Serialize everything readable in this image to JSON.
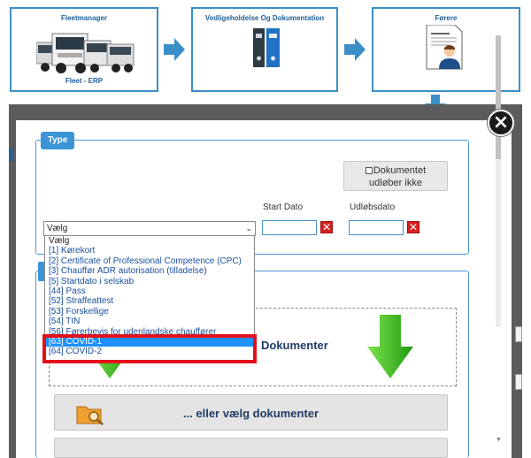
{
  "flow": {
    "step1": {
      "title": "Fleetmanager",
      "subtitle": "Fleet - ERP",
      "icon": "trucks-icon"
    },
    "step2": {
      "title": "Vedligeholdelse Og Dokumentation",
      "icon": "binders-icon"
    },
    "step3": {
      "title": "Førere",
      "icon": "driver-contract-icon"
    }
  },
  "modal": {
    "legend": "Type",
    "expires_never_checkbox": {
      "label_line1": "Dokumentet",
      "label_line2": "udløber ikke",
      "checked": false
    },
    "start_date_label": "Start Dato",
    "expiry_date_label": "Udløbsdato",
    "start_date_value": "",
    "expiry_date_value": "",
    "type_select": {
      "selected": "Vælg",
      "options": [
        "Vælg",
        "[1] Kørekort",
        "[2] Certificate of Professional Competence (CPC)",
        "[3] Chauffør ADR autorisation (tilladelse)",
        "[5] Startdato i selskab",
        "[44] Pass",
        "[52] Straffeattest",
        "[53] Forskellige",
        "[54] TIN",
        "[56] Førerbevis for udenlandske chauffører",
        "[63] COVID-1",
        "[64] COVID-2"
      ],
      "highlighted_index": 10
    },
    "drop_zone_text": "Dokumenter",
    "choose_docs_button": "... eller vælg dokumenter"
  },
  "colors": {
    "accent": "#3b94d6",
    "highlight": "#1e90ff",
    "annotation_frame": "#e3101a",
    "delete": "#d92020",
    "arrow_green": "#3fbf1f"
  }
}
